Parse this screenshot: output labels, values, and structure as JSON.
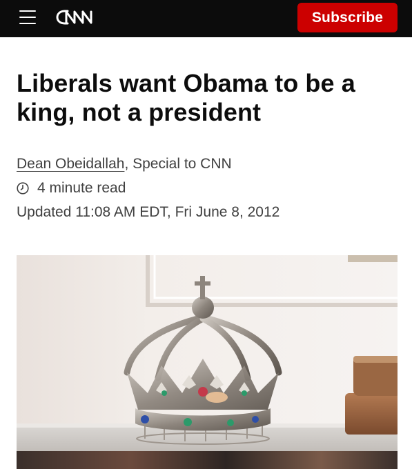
{
  "header": {
    "menu_icon": "hamburger-menu-icon",
    "logo_text": "CNN",
    "subscribe_label": "Subscribe",
    "colors": {
      "bar": "#0c0c0c",
      "subscribe": "#cc0000"
    }
  },
  "article": {
    "headline": "Liberals want Obama to be a king, not a president",
    "author": "Dean Obeidallah",
    "author_suffix": ", Special to CNN",
    "read_time_icon": "clock-icon",
    "read_time": "4 minute read",
    "updated": "Updated 11:08 AM EDT, Fri June 8, 2012"
  },
  "hero_image": {
    "subject": "ornate silver crown with jewels on a table"
  }
}
